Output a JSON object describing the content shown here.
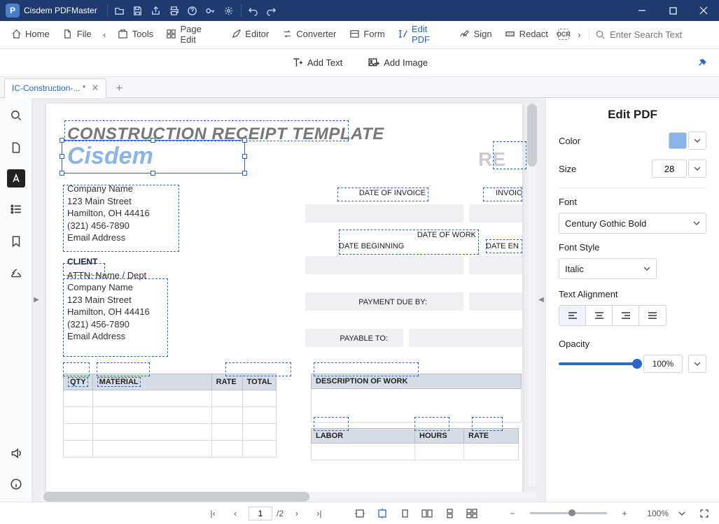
{
  "app": {
    "title": "Cisdem PDFMaster"
  },
  "toolbar": {
    "home": "Home",
    "file": "File",
    "tools": "Tools",
    "page_edit": "Page Edit",
    "editor": "Editor",
    "converter": "Converter",
    "form": "Form",
    "edit_pdf": "Edit PDF",
    "sign": "Sign",
    "redact": "Redact",
    "search_placeholder": "Enter Search Text"
  },
  "subtoolbar": {
    "add_text": "Add Text",
    "add_image": "Add Image"
  },
  "tab": {
    "name": "IC-Construction-... *"
  },
  "doc": {
    "title": "CONSTRUCTION RECEIPT TEMPLATE",
    "brand": "Cisdem",
    "receipt": "RE",
    "company": {
      "name": "Company Name",
      "street": "123 Main Street",
      "city": "Hamilton, OH  44416",
      "phone": "(321) 456-7890",
      "email": "Email Address"
    },
    "client_hdr": "CLIENT",
    "client": {
      "attn": "ATTN: Name / Dept",
      "name": "Company Name",
      "street": "123 Main Street",
      "city": "Hamilton, OH  44416",
      "phone": "(321) 456-7890",
      "email": "Email Address"
    },
    "labels": {
      "date_invoice": "DATE OF INVOICE",
      "invoice_no": "INVOIC",
      "date_work": "DATE OF WORK",
      "date_begin": "DATE BEGINNING",
      "date_end": "DATE EN",
      "payment_due": "PAYMENT DUE BY:",
      "payable_to": "PAYABLE TO:"
    },
    "table1": {
      "qty": "QTY",
      "material": "MATERIAL",
      "rate": "RATE",
      "total": "TOTAL"
    },
    "table2": {
      "desc": "DESCRIPTION OF WORK"
    },
    "table3": {
      "labor": "LABOR",
      "hours": "HOURS",
      "rate": "RATE"
    }
  },
  "panel": {
    "title": "Edit PDF",
    "color_label": "Color",
    "color_value": "#8ab3e8",
    "size_label": "Size",
    "size_value": "28",
    "font_label": "Font",
    "font_value": "Century Gothic Bold",
    "style_label": "Font Style",
    "style_value": "Italic",
    "align_label": "Text Alignment",
    "opacity_label": "Opacity",
    "opacity_value": "100%"
  },
  "status": {
    "page_current": "1",
    "page_total": "/2",
    "zoom": "100%"
  }
}
